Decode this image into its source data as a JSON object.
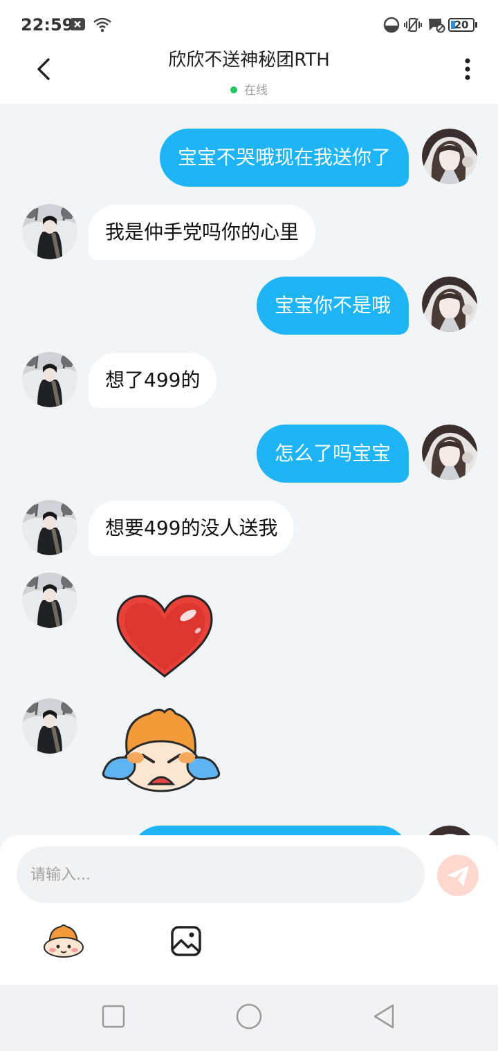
{
  "status_bar": {
    "time": "22:59",
    "battery": "20",
    "icons": [
      "notification-x-icon",
      "wifi-icon",
      "data-saver-icon",
      "vibrate-icon",
      "message-blocked-icon",
      "battery-icon"
    ]
  },
  "header": {
    "title": "欣欣不送神秘团RTH",
    "status": "在线",
    "status_color": "#22c55e"
  },
  "messages": [
    {
      "side": "right",
      "type": "text",
      "text": "宝宝不哭哦现在我送你了"
    },
    {
      "side": "left",
      "type": "text",
      "text": "我是仲手党吗你的心里"
    },
    {
      "side": "right",
      "type": "text",
      "text": "宝宝你不是哦"
    },
    {
      "side": "left",
      "type": "text",
      "text": "想了499的"
    },
    {
      "side": "right",
      "type": "text",
      "text": "怎么了吗宝宝"
    },
    {
      "side": "left",
      "type": "text",
      "text": "想要499的没人送我"
    },
    {
      "side": "left",
      "type": "sticker",
      "sticker": "heart-sticker"
    },
    {
      "side": "left",
      "type": "sticker",
      "sticker": "crying-cat-sticker"
    },
    {
      "side": "right",
      "type": "text",
      "text": ""
    }
  ],
  "composer": {
    "placeholder": "请输入...",
    "value": ""
  },
  "colors": {
    "bubble_right": "#1fb4f6",
    "bubble_left": "#ffffff",
    "chat_background": "#f2f5f8",
    "send_button": "#ffd9d0"
  }
}
